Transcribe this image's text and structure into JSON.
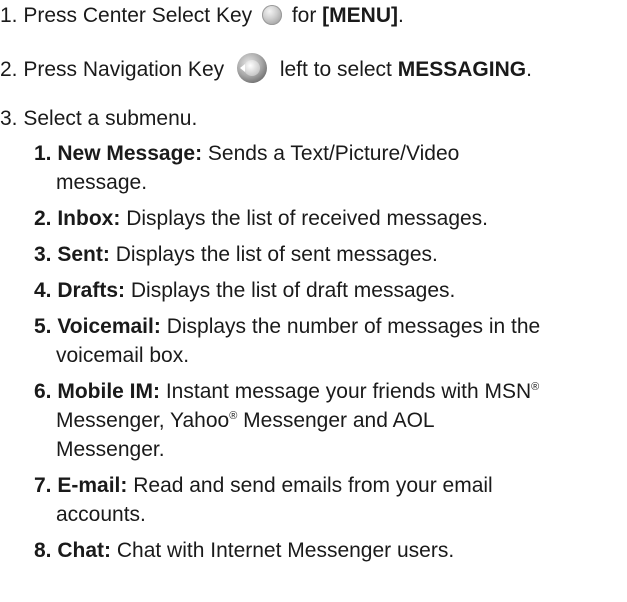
{
  "steps": [
    {
      "number": "1.",
      "text_a": "Press Center Select Key",
      "text_b": "for",
      "bold": "[MENU]",
      "end": ".",
      "icon": "center-select-key-icon"
    },
    {
      "number": "2.",
      "text_a": "Press Navigation Key",
      "text_b": "left to select",
      "bold": "MESSAGING",
      "end": ".",
      "icon": "navigation-key-icon"
    },
    {
      "number": "3.",
      "text_a": "Select a submenu."
    }
  ],
  "submenu": [
    {
      "label": "1. New Message:",
      "desc_1": "Sends a Text/Picture/Video",
      "desc_2": "message."
    },
    {
      "label": "2. Inbox:",
      "desc_1": "Displays the list of received messages."
    },
    {
      "label": "3. Sent:",
      "desc_1": "Displays the list of sent messages."
    },
    {
      "label": "4. Drafts:",
      "desc_1": "Displays the list of draft messages."
    },
    {
      "label": "5. Voicemail:",
      "desc_1": "Displays the number of messages in the",
      "desc_2": "voicemail box."
    },
    {
      "label": "6. Mobile IM:",
      "desc_1a": "Instant message your friends with MSN",
      "reg": "®",
      "desc_2a": "Messenger, Yahoo",
      "desc_2b": "Messenger and AOL",
      "desc_3": "Messenger."
    },
    {
      "label": "7. E-mail:",
      "desc_1": "Read and send emails from your email",
      "desc_2": "accounts."
    },
    {
      "label": "8. Chat:",
      "desc_1": "Chat with Internet Messenger users."
    }
  ]
}
